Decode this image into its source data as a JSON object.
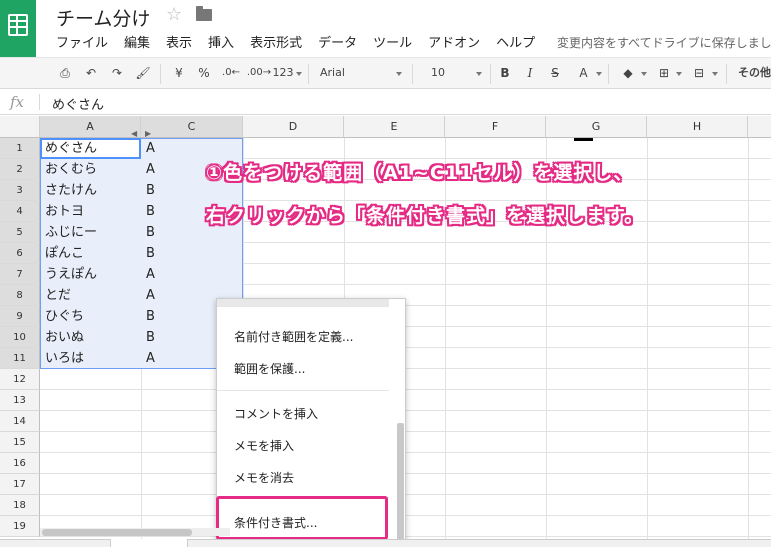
{
  "app": {
    "doc_title": "チーム分け",
    "save_status": "変更内容をすべてドライブに保存しました"
  },
  "menu": [
    "ファイル",
    "編集",
    "表示",
    "挿入",
    "表示形式",
    "データ",
    "ツール",
    "アドオン",
    "ヘルプ"
  ],
  "toolbar": {
    "currency": "¥",
    "percent": "%",
    "dec_decrease": ".0←",
    "dec_increase": ".00→",
    "number_format": "123",
    "font": "Arial",
    "font_size": "10",
    "bold": "B",
    "italic": "I",
    "strike": "S",
    "text_color": "A",
    "more": "その他"
  },
  "formula_bar": {
    "fx": "fx",
    "value": "めぐさん"
  },
  "columns": [
    "A",
    "C",
    "D",
    "E",
    "F",
    "G",
    "H"
  ],
  "rows": [
    "1",
    "2",
    "3",
    "4",
    "5",
    "6",
    "7",
    "8",
    "9",
    "10",
    "11",
    "12",
    "13",
    "14",
    "15",
    "16",
    "17",
    "18",
    "19"
  ],
  "cells": [
    [
      "めぐさん",
      "A"
    ],
    [
      "おくむら",
      "A"
    ],
    [
      "さたけん",
      "B"
    ],
    [
      "おトヨ",
      "B"
    ],
    [
      "ふじにー",
      "B"
    ],
    [
      "ぽんこ",
      "B"
    ],
    [
      "うえぽん",
      "A"
    ],
    [
      "とだ",
      "A"
    ],
    [
      "ひぐち",
      "B"
    ],
    [
      "おいぬ",
      "B"
    ],
    [
      "いろは",
      "A"
    ]
  ],
  "annotation": {
    "line1": "①色をつける範囲（A1~C11セル）を選択し、",
    "line2": "右クリックから「条件付き書式」を選択します。"
  },
  "context_menu": {
    "define_named_range": "名前付き範囲を定義...",
    "protect_range": "範囲を保護...",
    "insert_comment": "コメントを挿入",
    "insert_note": "メモを挿入",
    "clear_note": "メモを消去",
    "conditional_format": "条件付き書式..."
  },
  "colors": {
    "brand": "#1fa463",
    "selection": "#e8effa",
    "selection_border": "#6f9ef4",
    "annotation": "#e52b85"
  }
}
